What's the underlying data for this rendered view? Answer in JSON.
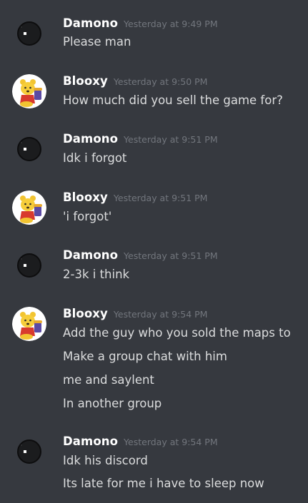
{
  "messages": [
    {
      "username": "Damono",
      "timestamp": "Yesterday at 9:49 PM",
      "avatar": "dark-orb-icon",
      "lines": [
        "Please man"
      ]
    },
    {
      "username": "Blooxy",
      "timestamp": "Yesterday at 9:50 PM",
      "avatar": "winnie-the-pooh-icon",
      "lines": [
        "How much did you sell the game for?"
      ]
    },
    {
      "username": "Damono",
      "timestamp": "Yesterday at 9:51 PM",
      "avatar": "dark-orb-icon",
      "lines": [
        "Idk i forgot"
      ]
    },
    {
      "username": "Blooxy",
      "timestamp": "Yesterday at 9:51 PM",
      "avatar": "winnie-the-pooh-icon",
      "lines": [
        "'i forgot'"
      ]
    },
    {
      "username": "Damono",
      "timestamp": "Yesterday at 9:51 PM",
      "avatar": "dark-orb-icon",
      "lines": [
        "2-3k i think"
      ]
    },
    {
      "username": "Blooxy",
      "timestamp": "Yesterday at 9:54 PM",
      "avatar": "winnie-the-pooh-icon",
      "lines": [
        "Add the guy who you sold the maps to",
        "Make a group chat with him",
        "me and saylent",
        "In another group"
      ]
    },
    {
      "username": "Damono",
      "timestamp": "Yesterday at 9:54 PM",
      "avatar": "dark-orb-icon",
      "lines": [
        "Idk his discord",
        "Its late for me i have to sleep now"
      ]
    }
  ],
  "colors": {
    "background": "#36393f",
    "username": "#ffffff",
    "timestamp": "#72767d",
    "message_text": "#dcddde"
  }
}
